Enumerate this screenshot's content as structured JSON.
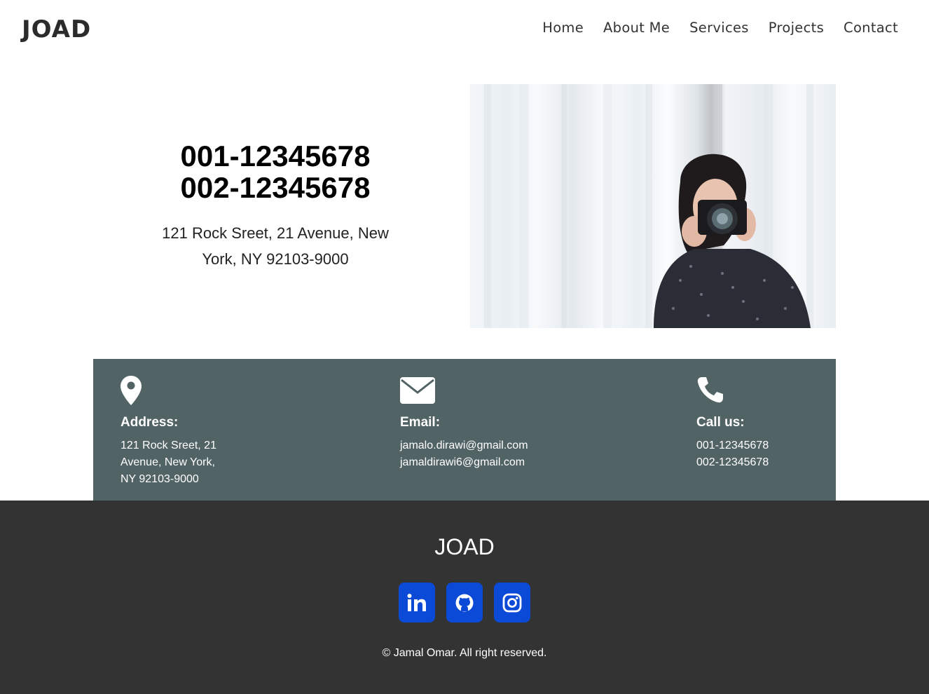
{
  "header": {
    "logo": "JOAD",
    "nav": [
      "Home",
      "About Me",
      "Services",
      "Projects",
      "Contact"
    ]
  },
  "hero": {
    "phone_1": "001-12345678",
    "phone_2": "002-12345678",
    "address": "121 Rock Sreet, 21 Avenue, New York, NY 92103-9000",
    "image_icon": "photographer-photo"
  },
  "info": {
    "address": {
      "icon": "map-pin-icon",
      "title": "Address:",
      "lines": [
        "121 Rock Sreet, 21",
        "Avenue, New York,",
        "NY 92103-9000"
      ]
    },
    "email": {
      "icon": "envelope-icon",
      "title": "Email:",
      "lines": [
        "jamalo.dirawi@gmail.com",
        "jamaldirawi6@gmail.com"
      ]
    },
    "call": {
      "icon": "phone-icon",
      "title": "Call us:",
      "lines": [
        "001-12345678",
        "002-12345678"
      ]
    }
  },
  "footer": {
    "logo": "JOAD",
    "socials": [
      "linkedin-icon",
      "github-icon",
      "instagram-icon"
    ],
    "copyright": "© Jamal Omar. All right reserved."
  },
  "colors": {
    "band": "#526366",
    "footer": "#333333",
    "social_button": "#0b4ad6"
  }
}
